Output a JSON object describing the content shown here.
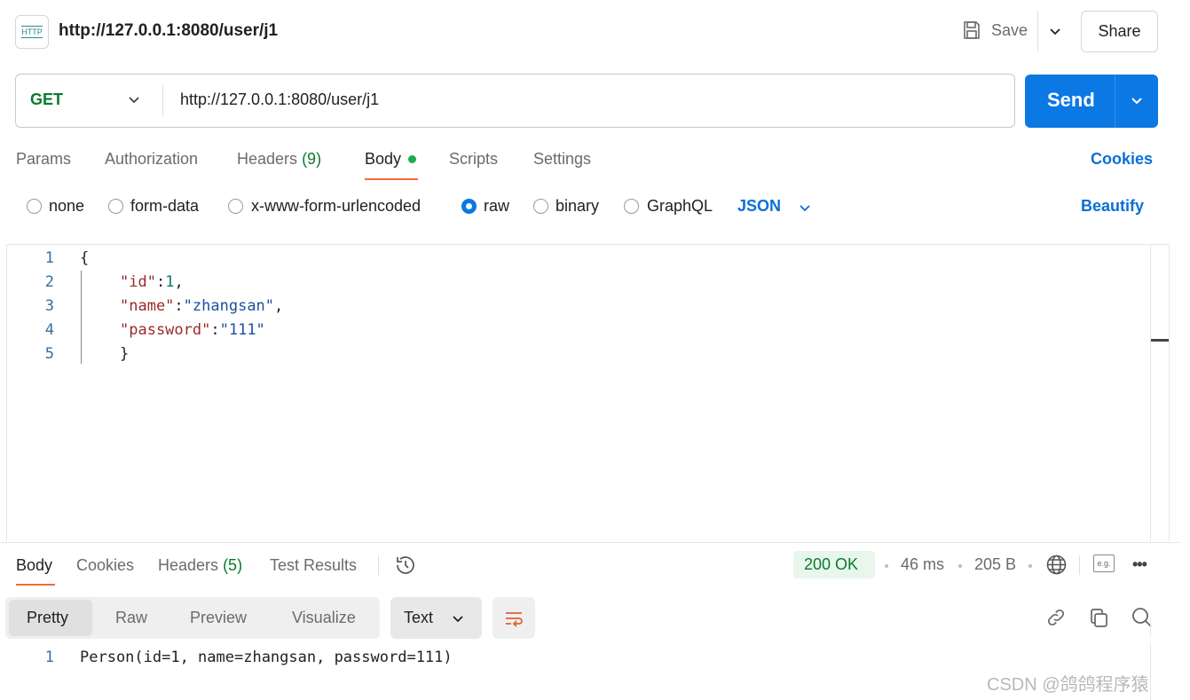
{
  "header": {
    "http_icon_label": "HTTP",
    "title": "http://127.0.0.1:8080/user/j1",
    "save_label": "Save",
    "share_label": "Share"
  },
  "request": {
    "method": "GET",
    "url": "http://127.0.0.1:8080/user/j1",
    "send_label": "Send"
  },
  "request_tabs": {
    "params": "Params",
    "authorization": "Authorization",
    "headers": "Headers",
    "headers_count": "(9)",
    "body": "Body",
    "scripts": "Scripts",
    "settings": "Settings",
    "cookies": "Cookies",
    "active": "Body"
  },
  "body_types": {
    "none": "none",
    "form_data": "form-data",
    "urlencoded": "x-www-form-urlencoded",
    "raw": "raw",
    "binary": "binary",
    "graphql": "GraphQL",
    "selected": "raw",
    "language": "JSON",
    "beautify": "Beautify"
  },
  "editor": {
    "line_numbers": [
      "1",
      "2",
      "3",
      "4",
      "5"
    ],
    "open_brace": "{",
    "close_brace": "}",
    "line2_key": "\"id\"",
    "line2_colon": ":",
    "line2_value": "1",
    "line2_comma": ",",
    "line3_key": "\"name\"",
    "line3_colon": ":",
    "line3_value": "\"zhangsan\"",
    "line3_comma": ",",
    "line4_key": "\"password\"",
    "line4_colon": ":",
    "line4_value": "\"111\""
  },
  "response_tabs": {
    "body": "Body",
    "cookies": "Cookies",
    "headers": "Headers",
    "headers_count": "(5)",
    "test_results": "Test Results",
    "active": "Body"
  },
  "response_meta": {
    "status": "200 OK",
    "time": "46 ms",
    "size": "205 B",
    "example_icon_label": "e.g.",
    "status_color": "#0a7a2e"
  },
  "format_bar": {
    "pretty": "Pretty",
    "raw": "Raw",
    "preview": "Preview",
    "visualize": "Visualize",
    "active": "Pretty",
    "text_type": "Text"
  },
  "response_body": {
    "line_number": "1",
    "content": "Person(id=1, name=zhangsan, password=111)"
  },
  "watermark": "CSDN @鸽鸽程序猿",
  "colors": {
    "send_button": "#0b78e3",
    "accent_underline": "#f26b3a",
    "link_blue": "#0b6fd6"
  }
}
